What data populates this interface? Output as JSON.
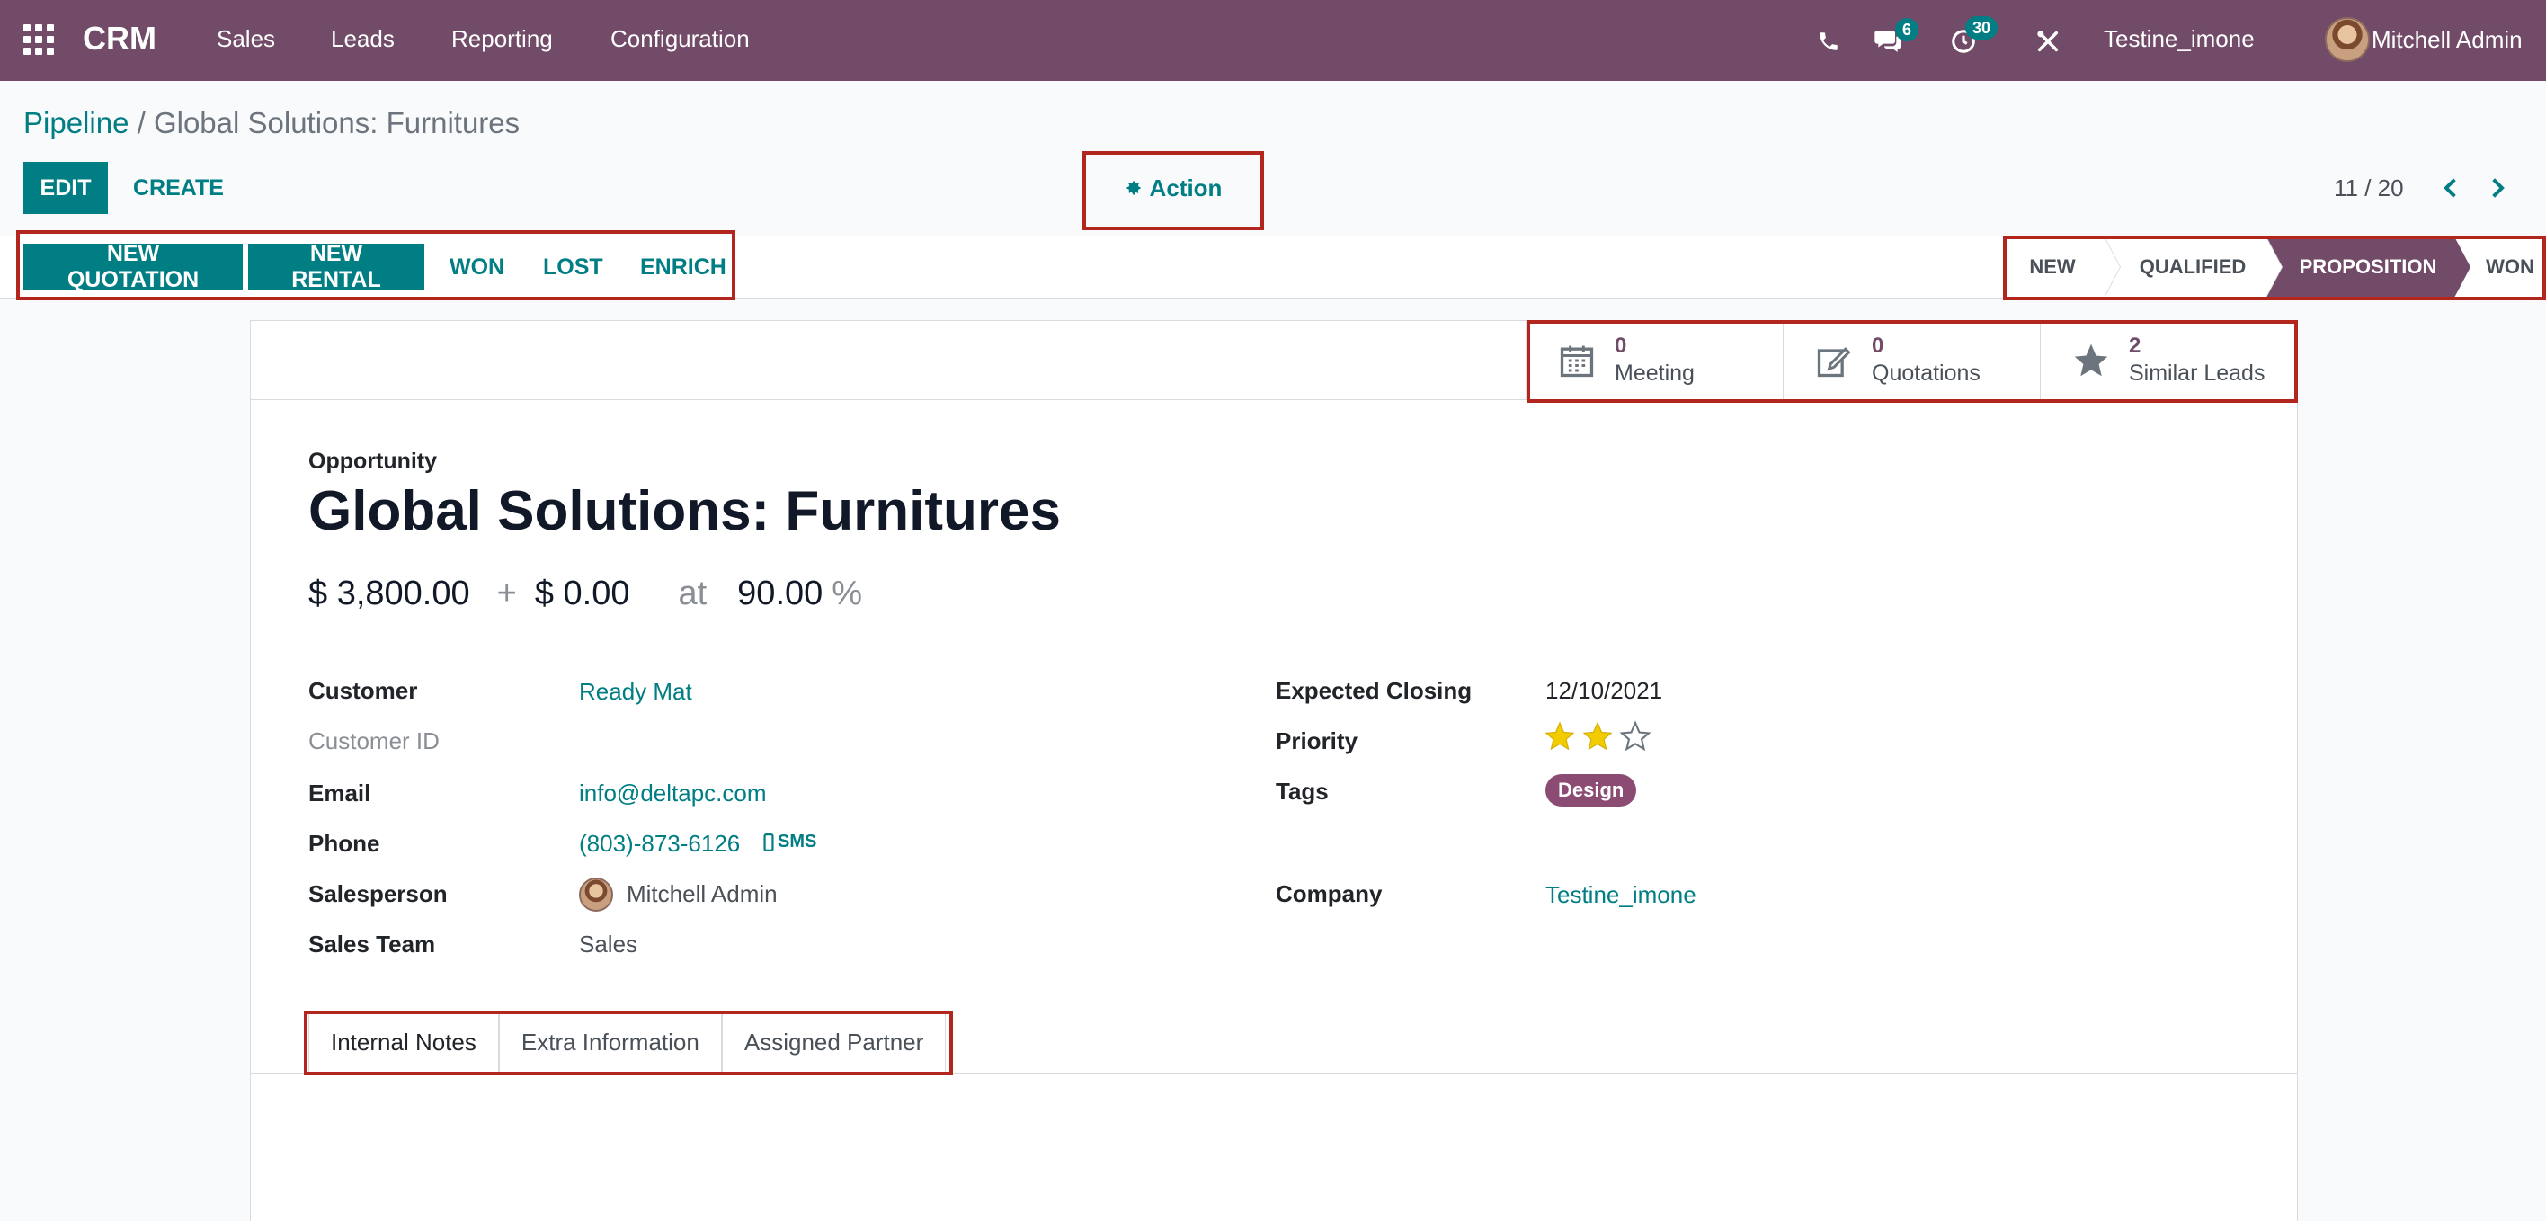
{
  "navbar": {
    "brand": "CRM",
    "menu": [
      "Sales",
      "Leads",
      "Reporting",
      "Configuration"
    ],
    "chat_badge": "6",
    "activity_badge": "30",
    "company": "Testine_imone",
    "user": "Mitchell Admin"
  },
  "breadcrumb": {
    "parent": "Pipeline",
    "separator": "/",
    "current": "Global Solutions: Furnitures"
  },
  "controls": {
    "edit": "EDIT",
    "create": "CREATE",
    "action": "Action",
    "pager": "11 / 20"
  },
  "statusbar": {
    "buttons": [
      "NEW QUOTATION",
      "NEW RENTAL",
      "WON",
      "LOST",
      "ENRICH"
    ],
    "stages": [
      "NEW",
      "QUALIFIED",
      "PROPOSITION",
      "WON"
    ],
    "active_stage": "PROPOSITION"
  },
  "smart_buttons": [
    {
      "value": "0",
      "label": "Meeting",
      "icon": "calendar-icon"
    },
    {
      "value": "0",
      "label": "Quotations",
      "icon": "edit-icon"
    },
    {
      "value": "2",
      "label": "Similar Leads",
      "icon": "star-icon"
    }
  ],
  "opportunity": {
    "label": "Opportunity",
    "title": "Global Solutions: Furnitures",
    "expected_revenue": "$ 3,800.00",
    "plus": "+",
    "recurring_revenue": "$ 0.00",
    "at": "at",
    "probability": "90.00",
    "percent": "%"
  },
  "fields_left": {
    "customer_label": "Customer",
    "customer_value": "Ready Mat",
    "customer_id_label": "Customer ID",
    "email_label": "Email",
    "email_value": "info@deltapc.com",
    "phone_label": "Phone",
    "phone_value": "(803)-873-6126",
    "sms": "SMS",
    "salesperson_label": "Salesperson",
    "salesperson_value": "Mitchell Admin",
    "sales_team_label": "Sales Team",
    "sales_team_value": "Sales"
  },
  "fields_right": {
    "expected_closing_label": "Expected Closing",
    "expected_closing_value": "12/10/2021",
    "priority_label": "Priority",
    "priority_stars": 2,
    "priority_max": 3,
    "tags_label": "Tags",
    "tag": "Design",
    "company_label": "Company",
    "company_value": "Testine_imone"
  },
  "tabs": [
    "Internal Notes",
    "Extra Information",
    "Assigned Partner"
  ],
  "colors": {
    "brand": "#714b67",
    "accent": "#017e84",
    "star": "#f3cc00",
    "tag": "#8b4b73",
    "highlight": "#b3261e"
  }
}
